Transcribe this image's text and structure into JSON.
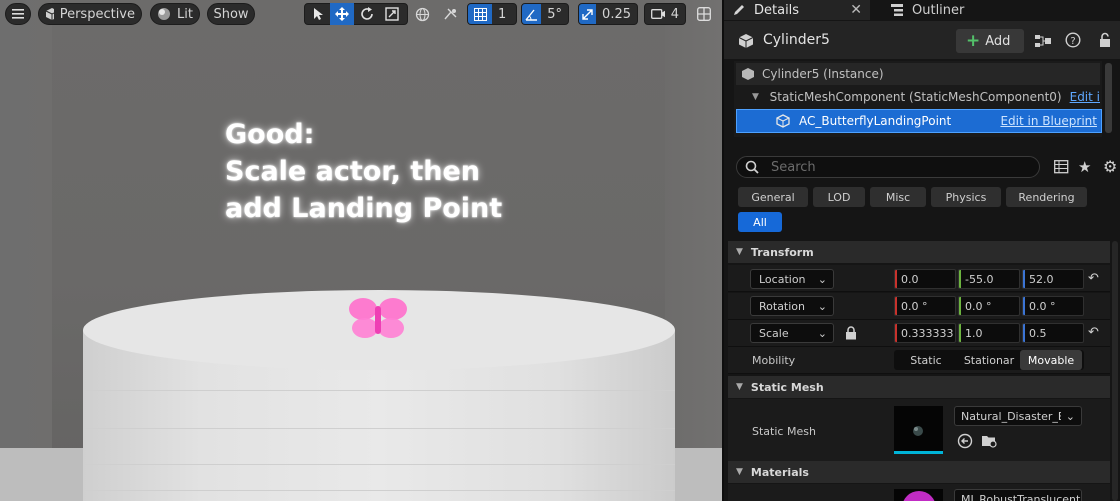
{
  "viewport": {
    "view_mode": "Perspective",
    "lighting": "Lit",
    "show": "Show",
    "grid_snap": "1",
    "rotation_snap": "5°",
    "scale_snap": "0.25",
    "camera_speed": "4",
    "overlay_text": {
      "line1": "Good:",
      "line2": "Scale actor, then",
      "line3": "add Landing Point"
    }
  },
  "panel": {
    "tabs": [
      {
        "label": "Details",
        "active": true
      },
      {
        "label": "Outliner",
        "active": false
      }
    ],
    "actor_name": "Cylinder5",
    "add_label": "Add",
    "components": [
      {
        "label": "Cylinder5 (Instance)",
        "link": ""
      },
      {
        "label": "StaticMeshComponent (StaticMeshComponent0)",
        "link": "Edit i"
      },
      {
        "label": "AC_ButterflyLandingPoint",
        "link": "Edit in Blueprint",
        "selected": true
      }
    ],
    "search_placeholder": "Search",
    "filters": [
      "General",
      "LOD",
      "Misc",
      "Physics",
      "Rendering",
      "All"
    ],
    "active_filter": "All",
    "transform": {
      "section": "Transform",
      "location": {
        "label": "Location",
        "x": "0.0",
        "y": "-55.0",
        "z": "52.0"
      },
      "rotation": {
        "label": "Rotation",
        "x": "0.0 °",
        "y": "0.0 °",
        "z": "0.0 °"
      },
      "scale": {
        "label": "Scale",
        "x": "0.333333",
        "y": "1.0",
        "z": "0.5"
      },
      "mobility": {
        "label": "Mobility",
        "options": [
          "Static",
          "Stationar",
          "Movable"
        ],
        "selected": "Movable"
      }
    },
    "static_mesh": {
      "section": "Static Mesh",
      "label": "Static Mesh",
      "value": "Natural_Disaster_B"
    },
    "materials": {
      "section": "Materials",
      "value": "MI_RobustTranslucent_Pi"
    }
  },
  "colors": {
    "accent": "#1c6cd3",
    "link": "#5fa8ff",
    "axis_x": "#c8322c",
    "axis_y": "#6cb33f",
    "axis_z": "#3b74d4",
    "butterfly": "#ff70d0"
  }
}
